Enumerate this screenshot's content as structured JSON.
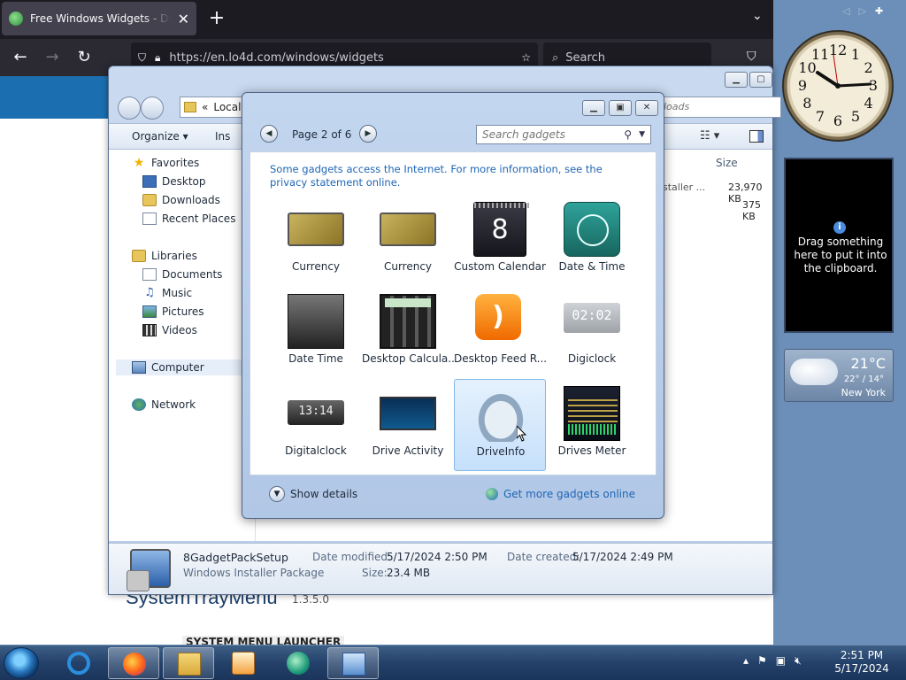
{
  "browser": {
    "tab_title": "Free Windows Widgets - Download",
    "new_tab": "+",
    "url": "https://en.lo4d.com/windows/widgets",
    "search_placeholder": "Search",
    "page": {
      "title": "SystemTrayMenu",
      "version": "1.3.5.0",
      "subheading": "SYSTEM MENU LAUNCHER"
    }
  },
  "explorer": {
    "address": "Local",
    "address_prefix": "«",
    "search_text": "loads",
    "toolbar": {
      "organize": "Organize",
      "install": "Ins"
    },
    "column_size": "Size",
    "rows": [
      {
        "type": "staller ...",
        "size": "23,970 KB"
      },
      {
        "type": "",
        "size": "375 KB"
      }
    ],
    "nav": {
      "favorites": "Favorites",
      "desktop": "Desktop",
      "downloads": "Downloads",
      "recent": "Recent Places",
      "libraries": "Libraries",
      "documents": "Documents",
      "music": "Music",
      "pictures": "Pictures",
      "videos": "Videos",
      "computer": "Computer",
      "network": "Network"
    },
    "details": {
      "name": "8GadgetPackSetup",
      "type": "Windows Installer Package",
      "modified_label": "Date modified:",
      "modified": "5/17/2024 2:50 PM",
      "size_label": "Size:",
      "size": "23.4 MB",
      "created_label": "Date created:",
      "created": "5/17/2024 2:49 PM"
    }
  },
  "gallery": {
    "page_label": "Page 2 of 6",
    "search_placeholder": "Search gadgets",
    "notice": "Some gadgets access the Internet.  For more information, see the privacy statement online.",
    "gadgets": [
      {
        "label": "Currency"
      },
      {
        "label": "Currency"
      },
      {
        "label": "Custom Calendar"
      },
      {
        "label": "Date & Time"
      },
      {
        "label": "Date Time"
      },
      {
        "label": "Desktop Calcula..."
      },
      {
        "label": "Desktop Feed R..."
      },
      {
        "label": "Digiclock"
      },
      {
        "label": "Digitalclock"
      },
      {
        "label": "Drive Activity"
      },
      {
        "label": "DriveInfo",
        "selected": true
      },
      {
        "label": "Drives Meter"
      }
    ],
    "thumb_text": {
      "calendar_day": "8",
      "digiclock": "02:02",
      "digitalclock": "13:14",
      "rss": ")"
    },
    "show_details": "Show details",
    "get_more": "Get more gadgets online"
  },
  "desktop": {
    "clock_numbers": [
      "12",
      "1",
      "2",
      "3",
      "4",
      "5",
      "6",
      "7",
      "8",
      "9",
      "10",
      "11"
    ],
    "clipboard_text": "Drag something here to put it into the clipboard.",
    "weather": {
      "temp": "21°C",
      "hilo": "22° / 14°",
      "city": "New York"
    }
  },
  "taskbar": {
    "time": "2:51 PM",
    "date": "5/17/2024"
  }
}
